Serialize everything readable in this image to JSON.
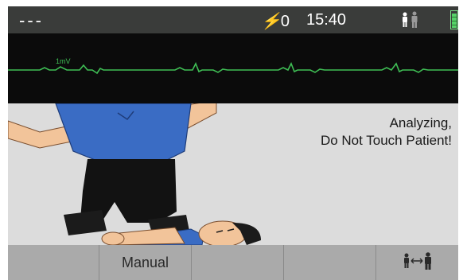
{
  "status": {
    "hr": "---",
    "shock_count": "0",
    "time": "15:40",
    "mode_icon": "adult-patient-icon",
    "battery_icon": "battery-full-icon"
  },
  "ecg": {
    "scale_label": "1mV",
    "trace_color": "#3fbf55"
  },
  "message": {
    "line1": "Analyzing,",
    "line2": "Do Not Touch Patient!"
  },
  "softkeys": [
    {
      "label": ""
    },
    {
      "label": "Manual"
    },
    {
      "label": ""
    },
    {
      "label": ""
    },
    {
      "label": "",
      "icon": "adult-pediatric-switch-icon"
    }
  ],
  "colors": {
    "statusbar": "#3a3c3a",
    "ecg_background": "#0b0b0b",
    "softkey_bar": "#aaaaaa",
    "battery": "#56d368"
  }
}
